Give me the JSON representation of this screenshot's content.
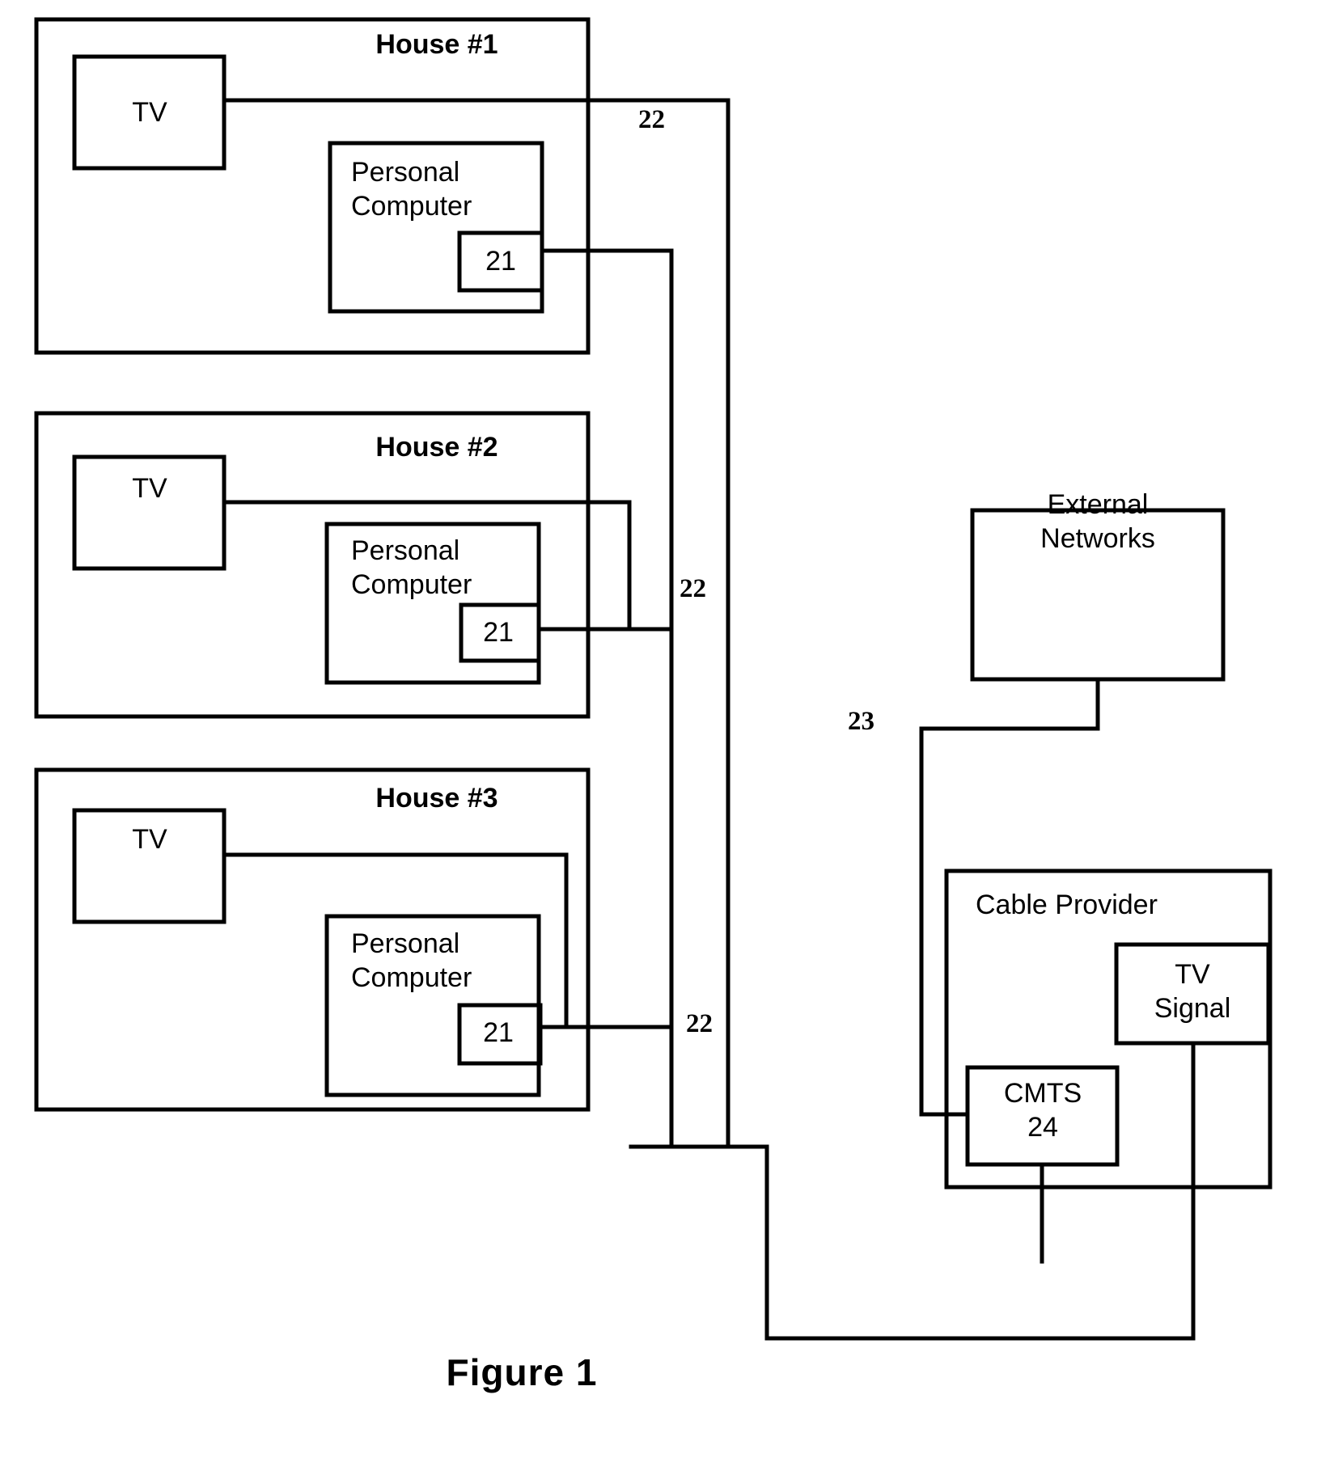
{
  "figure": {
    "caption": "Figure 1",
    "background_color": "#ffffff",
    "line_color": "#000000"
  },
  "houses": [
    {
      "title": "House #1",
      "tv_label": "TV",
      "pc_label_line1": "Personal",
      "pc_label_line2": "Computer",
      "modem_ref": "21"
    },
    {
      "title": "House #2",
      "tv_label": "TV",
      "pc_label_line1": "Personal",
      "pc_label_line2": "Computer",
      "modem_ref": "21"
    },
    {
      "title": "House #3",
      "tv_label": "TV",
      "pc_label_line1": "Personal",
      "pc_label_line2": "Computer",
      "modem_ref": "21"
    }
  ],
  "external_networks": {
    "label_line1": "External",
    "label_line2": "Networks"
  },
  "cable_provider": {
    "ref": "23",
    "title": "Cable Provider",
    "tv_signal_line1": "TV",
    "tv_signal_line2": "Signal",
    "cmts_line1": "CMTS",
    "cmts_line2": "24"
  },
  "cable_refs": {
    "top": "22",
    "middle": "22",
    "bottom": "22"
  }
}
